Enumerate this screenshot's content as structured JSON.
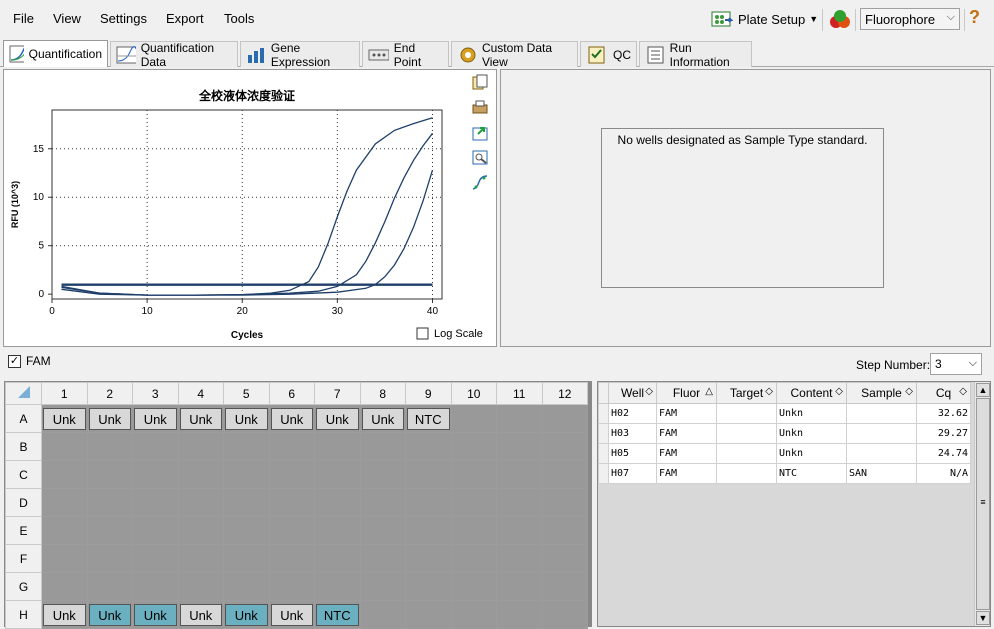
{
  "menu": {
    "file": "File",
    "view": "View",
    "settings": "Settings",
    "export": "Export",
    "tools": "Tools"
  },
  "toolbar": {
    "plate_setup": "Plate Setup",
    "fluorophore": "Fluorophore",
    "help": "?"
  },
  "tabs": [
    {
      "label": "Quantification"
    },
    {
      "label": "Quantification Data"
    },
    {
      "label": "Gene Expression"
    },
    {
      "label": "End Point"
    },
    {
      "label": "Custom Data View"
    },
    {
      "label": "QC"
    },
    {
      "label": "Run Information"
    }
  ],
  "chart_data": {
    "type": "line",
    "title": "全校液体浓度验证",
    "xlabel": "Cycles",
    "ylabel": "RFU (10^3)",
    "xlim": [
      0,
      41
    ],
    "ylim": [
      -0.5,
      19
    ],
    "xticks": [
      0,
      10,
      20,
      30,
      40
    ],
    "yticks": [
      0,
      5,
      10,
      15
    ],
    "grid": true,
    "color": "#1f3f6a",
    "series": [
      {
        "x": [
          1,
          5,
          10,
          15,
          20,
          23,
          25,
          27,
          28,
          29,
          30,
          31,
          32,
          34,
          36,
          38,
          40
        ],
        "y": [
          0.8,
          0.1,
          -0.1,
          -0.1,
          -0.05,
          0.1,
          0.4,
          1.3,
          2.8,
          5.2,
          8.0,
          10.6,
          12.8,
          15.5,
          16.9,
          17.6,
          18.2
        ]
      },
      {
        "x": [
          1,
          5,
          10,
          15,
          20,
          25,
          28,
          30,
          32,
          33,
          34,
          35,
          36,
          37,
          38,
          39,
          40
        ],
        "y": [
          0.7,
          0.1,
          -0.1,
          -0.1,
          -0.05,
          0.1,
          0.3,
          0.8,
          2.0,
          3.4,
          5.3,
          7.5,
          9.9,
          12.0,
          13.8,
          15.3,
          16.6
        ]
      },
      {
        "x": [
          1,
          5,
          10,
          15,
          20,
          25,
          30,
          33,
          34,
          35,
          36,
          37,
          38,
          39,
          40
        ],
        "y": [
          0.5,
          0.0,
          -0.1,
          -0.1,
          -0.1,
          0.0,
          0.2,
          0.6,
          1.0,
          1.8,
          3.0,
          4.7,
          6.9,
          9.6,
          12.8
        ]
      },
      {
        "x": [
          1,
          5,
          10,
          20,
          30,
          40
        ],
        "y": [
          1.0,
          1.0,
          1.0,
          1.0,
          1.0,
          1.0
        ]
      },
      {
        "x": [
          1,
          5,
          10,
          20,
          30,
          40
        ],
        "y": [
          0.95,
          0.95,
          0.95,
          0.95,
          0.95,
          0.95
        ]
      }
    ],
    "log_scale_label": "Log Scale"
  },
  "std_message": "No wells designated as Sample Type standard.",
  "fluor_filter": {
    "label": "FAM",
    "checked": "✓"
  },
  "step": {
    "label": "Step Number:",
    "value": "3"
  },
  "plate": {
    "columns": [
      "1",
      "2",
      "3",
      "4",
      "5",
      "6",
      "7",
      "8",
      "9",
      "10",
      "11",
      "12"
    ],
    "rows": [
      "A",
      "B",
      "C",
      "D",
      "E",
      "F",
      "G",
      "H"
    ],
    "wells": {
      "A": [
        "Unk",
        "Unk",
        "Unk",
        "Unk",
        "Unk",
        "Unk",
        "Unk",
        "Unk",
        "NTC",
        "",
        "",
        ""
      ],
      "B": [
        "",
        "",
        "",
        "",
        "",
        "",
        "",
        "",
        "",
        "",
        "",
        ""
      ],
      "C": [
        "",
        "",
        "",
        "",
        "",
        "",
        "",
        "",
        "",
        "",
        "",
        ""
      ],
      "D": [
        "",
        "",
        "",
        "",
        "",
        "",
        "",
        "",
        "",
        "",
        "",
        ""
      ],
      "E": [
        "",
        "",
        "",
        "",
        "",
        "",
        "",
        "",
        "",
        "",
        "",
        ""
      ],
      "F": [
        "",
        "",
        "",
        "",
        "",
        "",
        "",
        "",
        "",
        "",
        "",
        ""
      ],
      "G": [
        "",
        "",
        "",
        "",
        "",
        "",
        "",
        "",
        "",
        "",
        "",
        ""
      ],
      "H": [
        "Unk",
        "Unk",
        "Unk",
        "Unk",
        "Unk",
        "Unk",
        "NTC",
        "",
        "",
        "",
        "",
        ""
      ]
    },
    "selected": {
      "H": [
        1,
        2,
        4,
        6
      ]
    }
  },
  "results": {
    "headers": [
      "Well",
      "Fluor",
      "Target",
      "Content",
      "Sample",
      "Cq"
    ],
    "rows": [
      [
        "H02",
        "FAM",
        "",
        "Unkn",
        "",
        "32.62"
      ],
      [
        "H03",
        "FAM",
        "",
        "Unkn",
        "",
        "29.27"
      ],
      [
        "H05",
        "FAM",
        "",
        "Unkn",
        "",
        "24.74"
      ],
      [
        "H07",
        "FAM",
        "",
        "NTC",
        "SAN",
        "N/A"
      ]
    ]
  }
}
